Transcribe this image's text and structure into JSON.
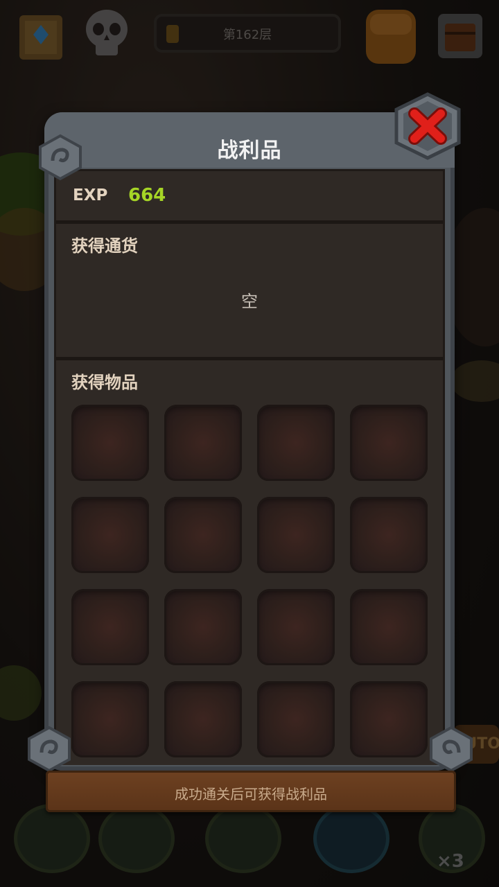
{
  "header": {
    "floor_label": "第162层",
    "subtitle_red": "■■■■■■■■■■"
  },
  "modal": {
    "title": "战利品",
    "exp": {
      "label": "EXP",
      "value": "664"
    },
    "currency": {
      "title": "获得通货",
      "empty_text": "空"
    },
    "items": {
      "title": "获得物品",
      "slot_count": 16
    },
    "footer_text": "成功通关后可获得战利品"
  },
  "background": {
    "auto_label": "AUTO",
    "speed_label": "×3"
  },
  "colors": {
    "exp_value": "#a6d526",
    "close_red": "#e0201a",
    "frame": "#50565c",
    "banner": "#6e4121"
  },
  "icons": {
    "close": "close-icon",
    "skull": "skull-icon",
    "map": "map-icon",
    "bag": "bag-icon",
    "chest": "chest-icon"
  }
}
